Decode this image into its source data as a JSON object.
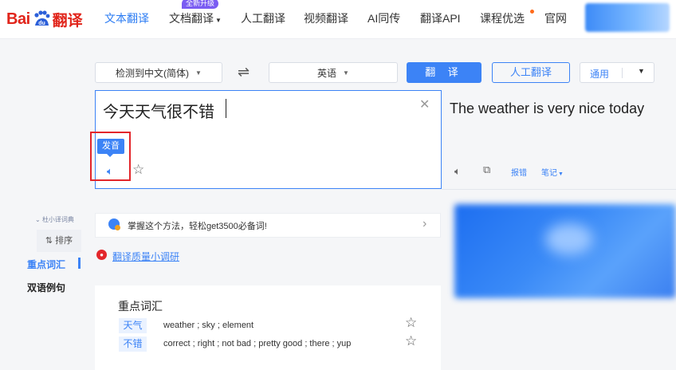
{
  "header": {
    "logo": {
      "bai": "Bai",
      "paw_text": "du",
      "translate": "翻译"
    },
    "nav_items": [
      "文本翻译",
      "文档翻译",
      "人工翻译",
      "视频翻译",
      "AI同传",
      "翻译API",
      "课程优选",
      "官网"
    ],
    "badge": "全新升级",
    "active_color": "#2a7bf3"
  },
  "toolbar": {
    "source_lang": "检测到中文(简体)",
    "target_lang": "英语",
    "swap_icon": "swap-arrows-icon",
    "translate_label": "翻 译",
    "human_label": "人工翻译",
    "domain_label": "通用"
  },
  "source": {
    "text": "今天天气很不错",
    "tooltip": "发音"
  },
  "result": {
    "text": "The weather is very nice today",
    "report": "报错",
    "notes": "笔记"
  },
  "side_menu": {
    "dict_tag": "杜小译词典",
    "sort": "排序",
    "key_vocab": "重点词汇",
    "bilingual": "双语例句"
  },
  "tip": {
    "text": "掌握这个方法，轻松get3500必备词!"
  },
  "survey": {
    "text": "翻译质量小调研"
  },
  "vocab": {
    "title": "重点词汇",
    "items": [
      {
        "word": "天气",
        "def": "weather ; sky ; element"
      },
      {
        "word": "不错",
        "def": "correct ; right ; not bad ; pretty good ; there ; yup"
      }
    ]
  },
  "colors": {
    "brand_red": "#e1251b",
    "accent_blue": "#3c83f6",
    "highlight_red": "#e3262b"
  }
}
